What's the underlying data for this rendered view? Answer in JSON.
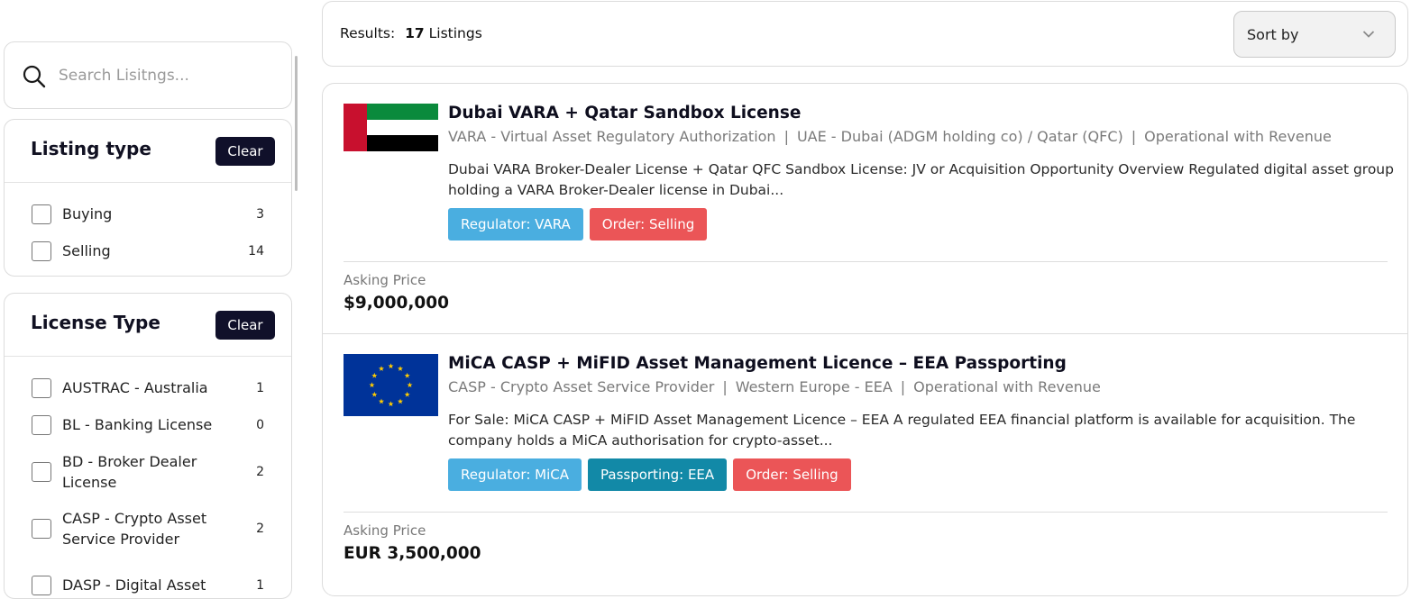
{
  "search": {
    "placeholder": "Search Lisitngs..."
  },
  "filters": {
    "listing_type": {
      "title": "Listing type",
      "clear_label": "Clear",
      "options": [
        {
          "label": "Buying",
          "count": "3"
        },
        {
          "label": "Selling",
          "count": "14"
        }
      ]
    },
    "license_type": {
      "title": "License Type",
      "clear_label": "Clear",
      "options": [
        {
          "label": "AUSTRAC - Australia",
          "count": "1"
        },
        {
          "label": "BL - Banking License",
          "count": "0"
        },
        {
          "label": "BD - Broker Dealer License",
          "count": "2"
        },
        {
          "label": "CASP - Crypto Asset Service Provider",
          "count": "2"
        },
        {
          "label": "DASP - Digital Asset",
          "count": "1"
        }
      ]
    }
  },
  "results": {
    "prefix": "Results:",
    "count": "17",
    "suffix": "Listings"
  },
  "sort": {
    "label": "Sort by",
    "icon": "chevron-down-icon"
  },
  "listings": [
    {
      "flag": "uae-flag",
      "title": "Dubai VARA + Qatar Sandbox License",
      "meta": [
        "VARA - Virtual Asset Regulatory Authorization",
        "UAE - Dubai (ADGM holding co) / Qatar (QFC)",
        "Operational with Revenue"
      ],
      "description": "Dubai VARA Broker-Dealer License + Qatar QFC Sandbox License: JV or Acquisition Opportunity Overview Regulated digital asset group holding a VARA Broker-Dealer license in Dubai...",
      "tags": [
        {
          "text": "Regulator:  VARA",
          "color": "#4aaee0"
        },
        {
          "text": "Order:  Selling",
          "color": "#eb5557"
        }
      ],
      "price_label": "Asking Price",
      "price": "$9,000,000"
    },
    {
      "flag": "eu-flag",
      "title": "MiCA CASP + MiFID Asset Management Licence – EEA Passporting",
      "meta": [
        "CASP - Crypto Asset Service Provider",
        "Western Europe - EEA",
        "Operational with Revenue"
      ],
      "description": "For Sale: MiCA CASP + MiFID Asset Management Licence – EEA A regulated EEA financial platform is available for acquisition. The company holds a MiCA authorisation for crypto-asset...",
      "tags": [
        {
          "text": "Regulator:  MiCA",
          "color": "#4aaee0"
        },
        {
          "text": "Passporting:  EEA",
          "color": "#1289a7"
        },
        {
          "text": "Order:  Selling",
          "color": "#eb5557"
        }
      ],
      "price_label": "Asking Price",
      "price": "EUR 3,500,000"
    }
  ],
  "meta_separator": "|"
}
